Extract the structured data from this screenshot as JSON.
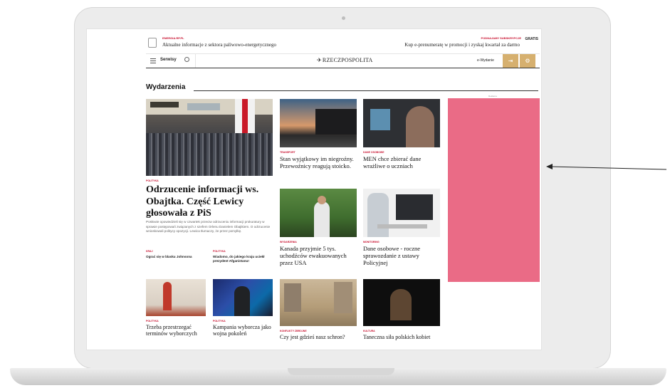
{
  "header": {
    "promo_tag": "ENERGIA.RP.PL",
    "promo_text": "Aktualne informacje z sektora paliwowo-energetycznego",
    "sub_tag": "PODNAJAMY SUBSKRYPCJE",
    "sub_text": "Kup e-prenumeratę w promocji i zyskaj kwartał za darmo",
    "gratis": "GRATIS"
  },
  "nav": {
    "serwisy": "Serwisy",
    "logo": "RZECZPOSPOLITA",
    "ewydanie": "e-Wydanie",
    "login_icon": "login-icon",
    "settings_icon": "settings-icon"
  },
  "section": {
    "title": "Wydarzenia"
  },
  "main_article": {
    "tag": "POLITYKA",
    "title": "Odrzucenie informacji ws. Obajtka. Część Lewicy głosowała z PiS",
    "lead": "Posłowie opowiedzieli się w czwartek przeciw odrzuceniu informacji prokuratury w sprawie postępowań związanych z szefem Orlenu Danielem Obajtkiem. O odrzucenie wnioskowali politycy opozycji. Lewica tłumaczy, że przez pomyłkę.",
    "related": [
      {
        "tag": "KRAJ",
        "title": "Ograć się w blasku Johnsona"
      },
      {
        "tag": "POLITYKA",
        "title": "Wiadomo, do jakiego kraju uciekł prezydent Afganistanu!"
      }
    ]
  },
  "articles": [
    {
      "tag": "TRANSPORT",
      "title": "Stan wyjątkowy im niegroźny. Przewoźnicy reagują stoicko."
    },
    {
      "tag": "DANE OSOBOWE",
      "title": "MEN chce zbierać dane wrażliwe o uczniach"
    },
    {
      "tag": "WYDARZENIA",
      "title": "Kanada przyjmie 5 tys. uchodźców ewakuowanych przez USA"
    },
    {
      "tag": "MONITORING",
      "title": "Dane osobowe - roczne sprawozdanie z ustawy Policyjnej"
    },
    {
      "tag": "POLITYKA",
      "title": "Trzeba przestrzegać terminów wyborczych"
    },
    {
      "tag": "POLITYKA",
      "title": "Kampania wyborcza jako wojna pokoleń"
    },
    {
      "tag": "KONFLIKTY ZBROJNE",
      "title": "Czy jest gdzieś nasz schron?"
    },
    {
      "tag": "KULTURA",
      "title": "Taneczna siła polskich kobiet"
    }
  ],
  "ad": {
    "label": "Reklama",
    "color": "#ea6b86"
  },
  "colors": {
    "accent": "#c8102e",
    "gold": "#d6b06f"
  }
}
